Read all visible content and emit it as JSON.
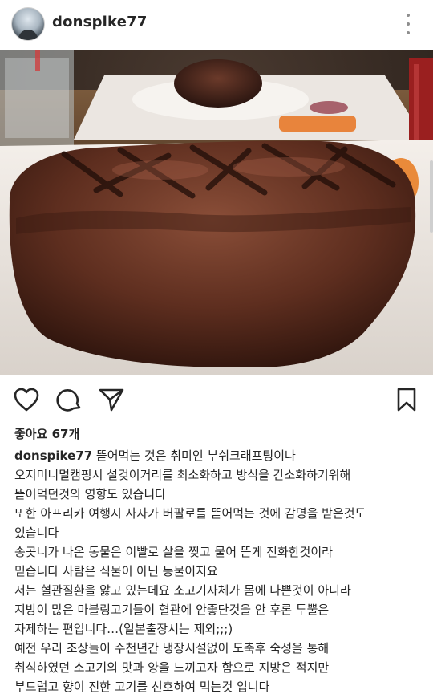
{
  "post": {
    "username": "donspike77",
    "likes_text": "좋아요 67개",
    "caption_username": "donspike77",
    "caption_lines": [
      " 뜯어먹는 것은 취미인 부쉬크래프팅이나",
      "오지미니멀캠핑시 설겆이거리를 최소화하고 방식을 간소화하기위해",
      "뜯어먹던것의 영향도 있습니다",
      "또한 아프리카 여행시 사자가 버팔로를 뜯어먹는 것에 감명을 받은것도",
      "있습니다",
      "송곳니가 나온 동물은 이빨로 살을 찢고 물어 뜯게 진화한것이라",
      "믿습니다 사람은 식물이 아닌 동물이지요",
      "저는 혈관질환을 앓고 있는데요 소고기자체가 몸에 나쁜것이 아니라",
      "지방이 많은 마블링고기들이 혈관에 안좋단것을 안 후론 투뿔은",
      "자제하는 편입니다…(일본출장시는 제외;;;)",
      "예전 우리 조상들이 수천년간 냉장시설없이 도축후 숙성을 통해",
      "취식하였던 소고기의 맛과 양을 느끼고자 함으로 지방은 적지만",
      "부드럽고 향이 진한 고기를 선호하여 먹는것 입니다"
    ]
  },
  "icons": {
    "avatar": "avatar",
    "more": "more-options-icon",
    "like": "heart-icon",
    "comment": "comment-icon",
    "share": "send-icon",
    "save": "bookmark-icon"
  },
  "colors": {
    "text": "#262626",
    "secondary": "#8e8e8e",
    "background": "#ffffff"
  }
}
